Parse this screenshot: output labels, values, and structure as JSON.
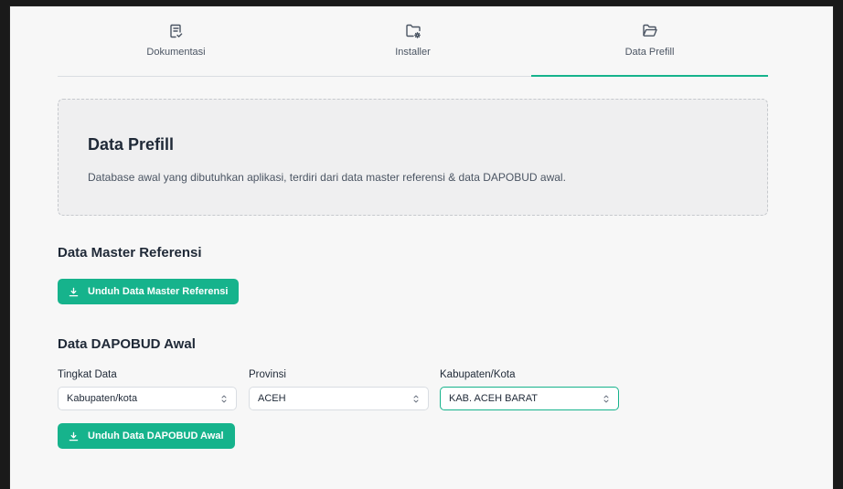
{
  "tabs": [
    {
      "label": "Dokumentasi",
      "icon": "document-check-icon",
      "active": false
    },
    {
      "label": "Installer",
      "icon": "folder-gear-icon",
      "active": false
    },
    {
      "label": "Data Prefill",
      "icon": "folder-open-icon",
      "active": true
    }
  ],
  "info": {
    "title": "Data Prefill",
    "description": "Database awal yang dibutuhkan aplikasi, terdiri dari data master referensi & data DAPOBUD awal."
  },
  "master": {
    "title": "Data Master Referensi",
    "button_label": "Unduh Data Master Referensi"
  },
  "dapobud": {
    "title": "Data DAPOBUD Awal",
    "fields": {
      "tingkat": {
        "label": "Tingkat Data",
        "value": "Kabupaten/kota"
      },
      "provinsi": {
        "label": "Provinsi",
        "value": "ACEH"
      },
      "kabupaten": {
        "label": "Kabupaten/Kota",
        "value": "KAB. ACEH BARAT"
      }
    },
    "button_label": "Unduh Data DAPOBUD Awal"
  },
  "colors": {
    "accent": "#16b38c",
    "background": "#f7f7f7"
  }
}
